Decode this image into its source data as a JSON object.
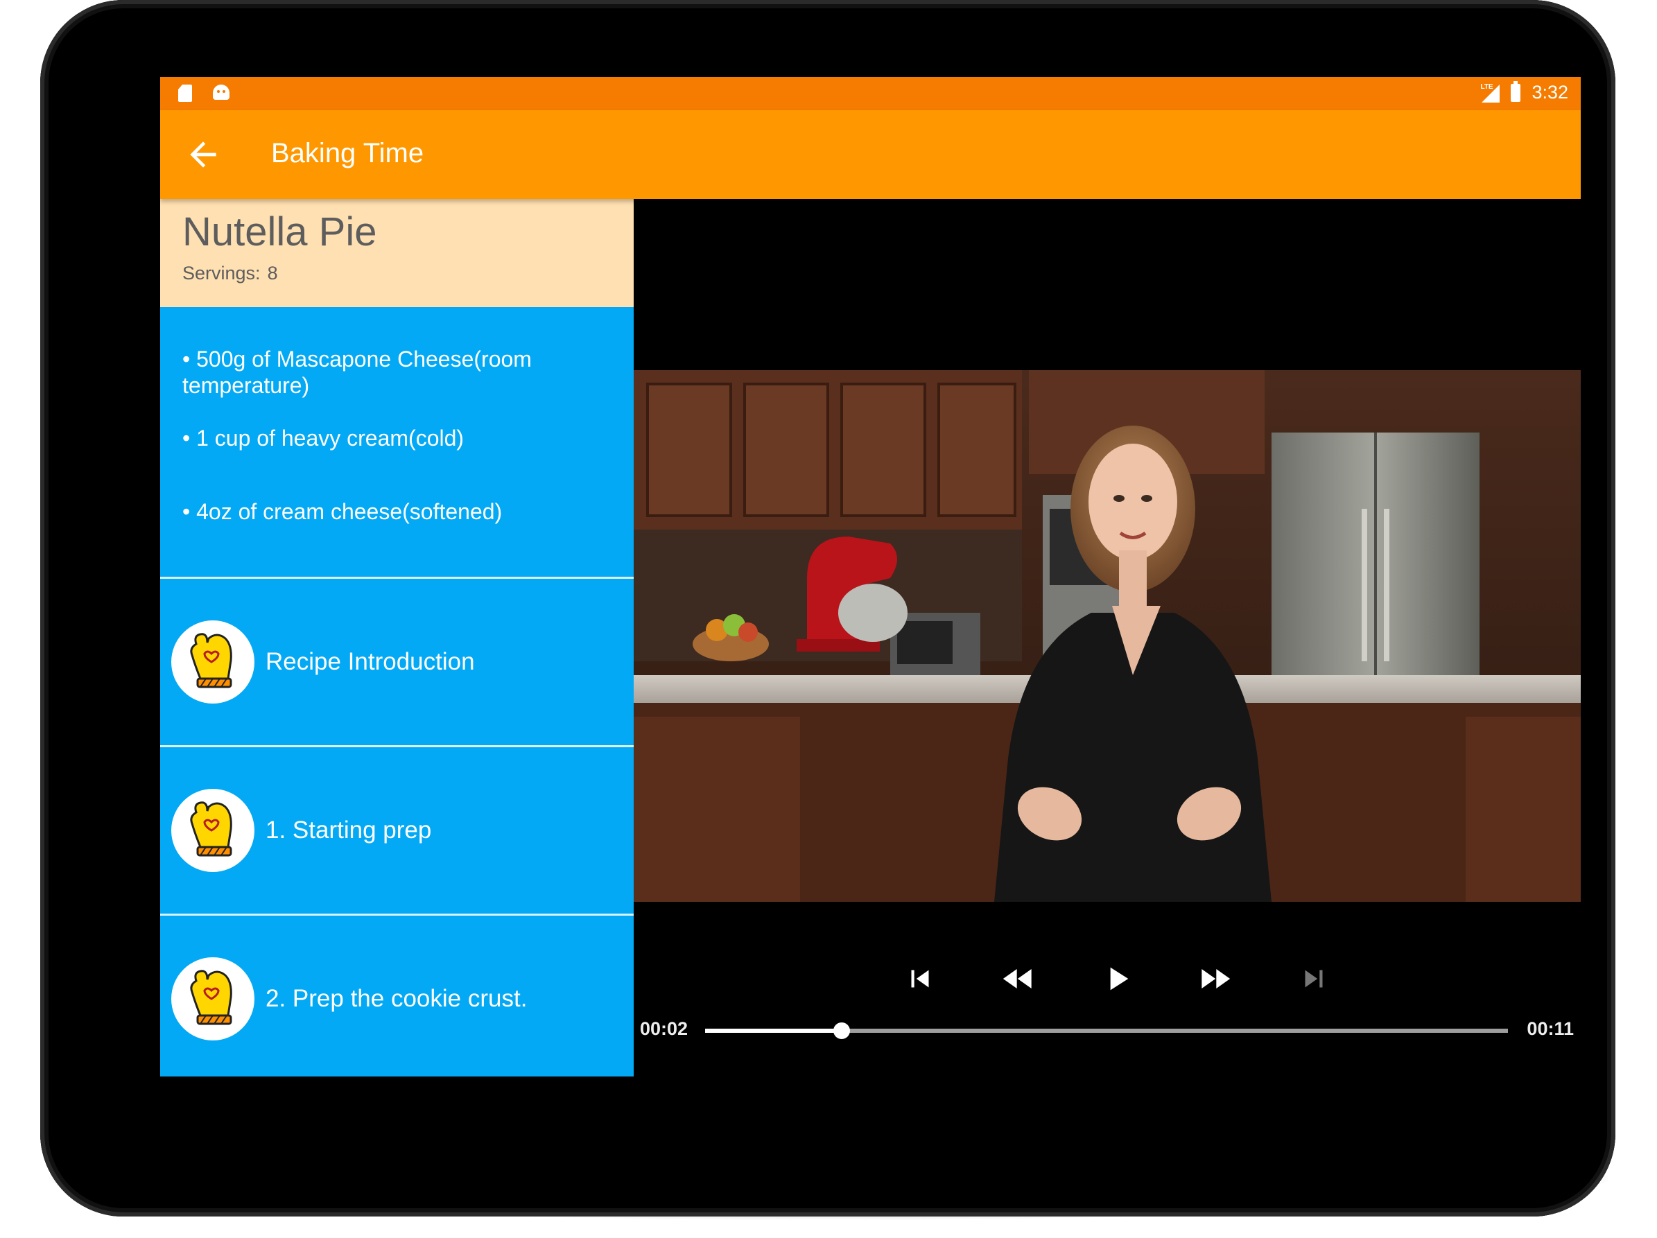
{
  "status_bar": {
    "time": "3:32",
    "network": "LTE"
  },
  "app_bar": {
    "title": "Baking Time"
  },
  "recipe": {
    "name": "Nutella Pie",
    "servings_label": "Servings:",
    "servings_value": "8"
  },
  "ingredients": [
    "• 500g of Mascapone Cheese(room temperature)",
    "• 1 cup of heavy cream(cold)",
    "• 4oz of cream cheese(softened)"
  ],
  "steps": [
    {
      "label": "Recipe Introduction",
      "icon": "oven-mitt-icon"
    },
    {
      "label": "1. Starting prep",
      "icon": "oven-mitt-icon"
    },
    {
      "label": "2. Prep the cookie crust.",
      "icon": "oven-mitt-icon"
    }
  ],
  "player": {
    "current_time": "00:02",
    "duration": "00:11",
    "progress": 0.17
  },
  "colors": {
    "status_bar": "#f57c00",
    "app_bar": "#ff9800",
    "recipe_header": "#ffe0b2",
    "step_list": "#03a9f4"
  }
}
